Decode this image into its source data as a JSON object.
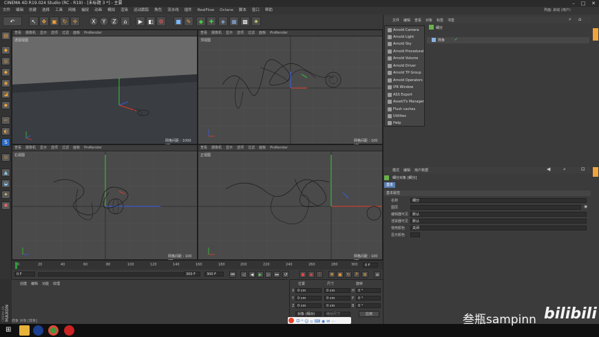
{
  "window": {
    "title": "CINEMA 4D R19.024 Studio (RC - R19) - [未标题 3 *] - 主要",
    "layout_label": "界面: 启动 (用户)"
  },
  "menu": [
    "文件",
    "编辑",
    "创建",
    "选择",
    "工具",
    "网格",
    "捕捉",
    "动画",
    "模拟",
    "渲染",
    "运动跟踪",
    "角色",
    "流水线",
    "插件",
    "RealFlow",
    "Octane",
    "脚本",
    "窗口",
    "帮助"
  ],
  "toolbar": {
    "axes": [
      "X",
      "Y",
      "Z"
    ]
  },
  "viewport_menu": [
    "查看",
    "摄像机",
    "显示",
    "选项",
    "过滤",
    "面板",
    "ProRender"
  ],
  "viewports": [
    {
      "label": "透视视图",
      "grid": "网格间距 : 1000 cm"
    },
    {
      "label": "顶视图",
      "grid": "网格间距 : 100 cm"
    },
    {
      "label": "右视图",
      "grid": "网格间距 : 100 cm"
    },
    {
      "label": "正视图",
      "grid": "网格间距 : 100 cm"
    }
  ],
  "object_manager": {
    "menu": [
      "文件",
      "编辑",
      "查看",
      "对象",
      "标签",
      "书签"
    ],
    "objects": [
      "细分",
      "样条"
    ]
  },
  "arnold_menu": [
    "Arnold Camera",
    "Arnold Light",
    "Arnold Sky",
    "Arnold Procedural",
    "Arnold Volume",
    "Arnold Driver",
    "Arnold TP Group",
    "Arnold Operators",
    "IPR Window",
    "ASS Export",
    "Asset/Tx Manager",
    "Flush caches",
    "Utilities",
    "Help"
  ],
  "attributes": {
    "menu": [
      "模式",
      "编辑",
      "用户数据"
    ],
    "header": "细分对象 [细分]",
    "tab": "基本",
    "section": "基本属性",
    "rows": [
      {
        "label": "名称",
        "value": "细分"
      },
      {
        "label": "图层",
        "value": ""
      },
      {
        "label": "编辑器可见",
        "value": "默认"
      },
      {
        "label": "渲染器可见",
        "value": "默认"
      },
      {
        "label": "使用颜色",
        "value": "关闭"
      },
      {
        "label": "显示颜色",
        "value": ""
      }
    ]
  },
  "timeline": {
    "ticks": [
      "0",
      "20",
      "40",
      "60",
      "80",
      "100",
      "120",
      "140",
      "160",
      "180",
      "200",
      "220",
      "240",
      "260",
      "280",
      "300"
    ],
    "frame": "0 F",
    "start": "0 F",
    "end": "300 F",
    "end2": "300 F"
  },
  "material_manager": {
    "menu": [
      "创建",
      "编辑",
      "功能",
      "纹理"
    ]
  },
  "coordinates": {
    "headers": [
      "位置",
      "尺寸",
      "旋转"
    ],
    "rows": [
      {
        "axis": "X",
        "pos": "0 cm",
        "size": "0 cm",
        "rot_axis": "H",
        "rot": "0 °"
      },
      {
        "axis": "Y",
        "pos": "0 cm",
        "size": "0 cm",
        "rot_axis": "P",
        "rot": "0 °"
      },
      {
        "axis": "Z",
        "pos": "0 cm",
        "size": "0 cm",
        "rot_axis": "B",
        "rot": "0 °"
      }
    ],
    "mode": "对象 (相对)",
    "size_mode": "绝对尺寸",
    "apply": "应用"
  },
  "status_bar": "样条 对象 [样条]",
  "watermark": {
    "author": "叁瓶sampinn",
    "site": "bilibili"
  },
  "colors": {
    "x_axis": "#e23a2a",
    "y_axis": "#33cc33",
    "z_axis": "#3a5ce6",
    "spline": "#1a1a1a"
  }
}
